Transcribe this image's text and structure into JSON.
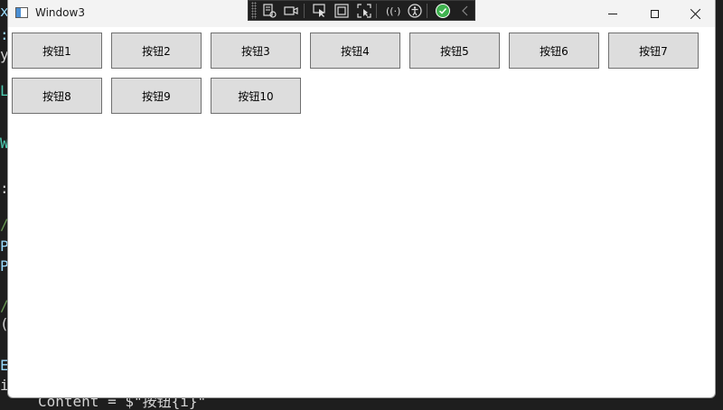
{
  "window": {
    "title": "Window3"
  },
  "buttons": [
    "按钮1",
    "按钮2",
    "按钮3",
    "按钮4",
    "按钮5",
    "按钮6",
    "按钮7",
    "按钮8",
    "按钮9",
    "按钮10"
  ],
  "editor": {
    "bottom_line": "Content = $\"按钮{i}\""
  },
  "colors": {
    "button_bg": "#dddddd",
    "button_border": "#707070",
    "toolbar_bg": "#1f1f1f",
    "check_green": "#3fb24f",
    "editor_bg": "#1e1e1e"
  }
}
